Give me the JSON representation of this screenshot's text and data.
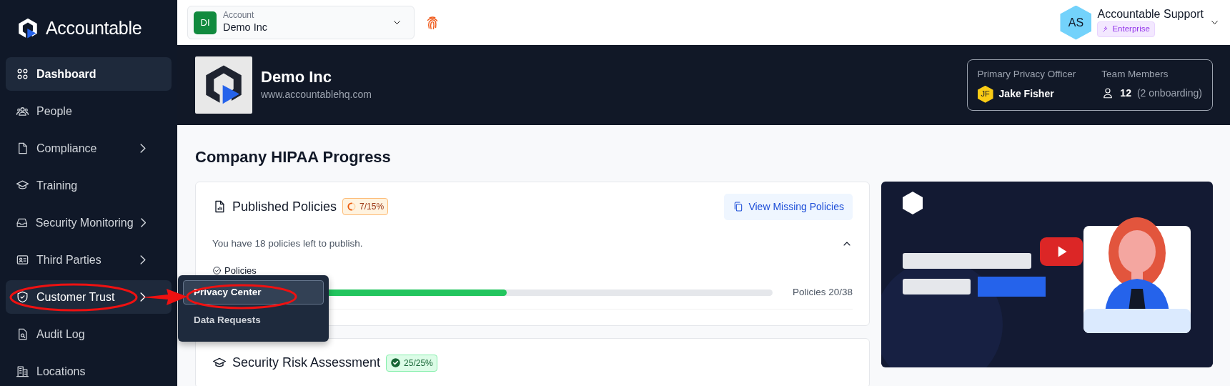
{
  "sidebar": {
    "logo_text": "Accountable",
    "items": [
      {
        "label": "Dashboard",
        "selected": true,
        "has_submenu": false,
        "open": false
      },
      {
        "label": "People",
        "selected": false,
        "has_submenu": false,
        "open": false
      },
      {
        "label": "Compliance",
        "selected": false,
        "has_submenu": true,
        "open": false
      },
      {
        "label": "Training",
        "selected": false,
        "has_submenu": false,
        "open": false
      },
      {
        "label": "Security Monitoring",
        "selected": false,
        "has_submenu": true,
        "open": false
      },
      {
        "label": "Third Parties",
        "selected": false,
        "has_submenu": true,
        "open": false
      },
      {
        "label": "Customer Trust",
        "selected": false,
        "has_submenu": true,
        "open": true
      },
      {
        "label": "Audit Log",
        "selected": false,
        "has_submenu": false,
        "open": false
      },
      {
        "label": "Locations",
        "selected": false,
        "has_submenu": false,
        "open": false
      }
    ]
  },
  "submenu": {
    "items": [
      {
        "label": "Privacy Center",
        "selected": true
      },
      {
        "label": "Data Requests",
        "selected": false
      }
    ]
  },
  "topbar": {
    "account": {
      "initials": "DI",
      "label": "Account",
      "value": "Demo Inc"
    },
    "user": {
      "initials": "AS",
      "name": "Accountable Support",
      "plan": "Enterprise"
    }
  },
  "company": {
    "name": "Demo Inc",
    "website": "www.accountablehq.com",
    "officer_label": "Primary Privacy Officer",
    "officer_initials": "JF",
    "officer_name": "Jake Fisher",
    "team_label": "Team Members",
    "team_count": "12",
    "team_note": "(2 onboarding)"
  },
  "page_title": "Company HIPAA Progress",
  "cards": [
    {
      "title": "Published Policies",
      "badge": "7/15%",
      "kind": "in_progress",
      "action": "View Missing Policies",
      "message": "You have 18 policies left to publish.",
      "expanded": true,
      "progress": {
        "label": "Policies",
        "level": 0.526,
        "reading": "Policies 20/38"
      }
    },
    {
      "title": "Security Risk Assessment",
      "badge": "25/25%",
      "kind": "complete"
    }
  ]
}
